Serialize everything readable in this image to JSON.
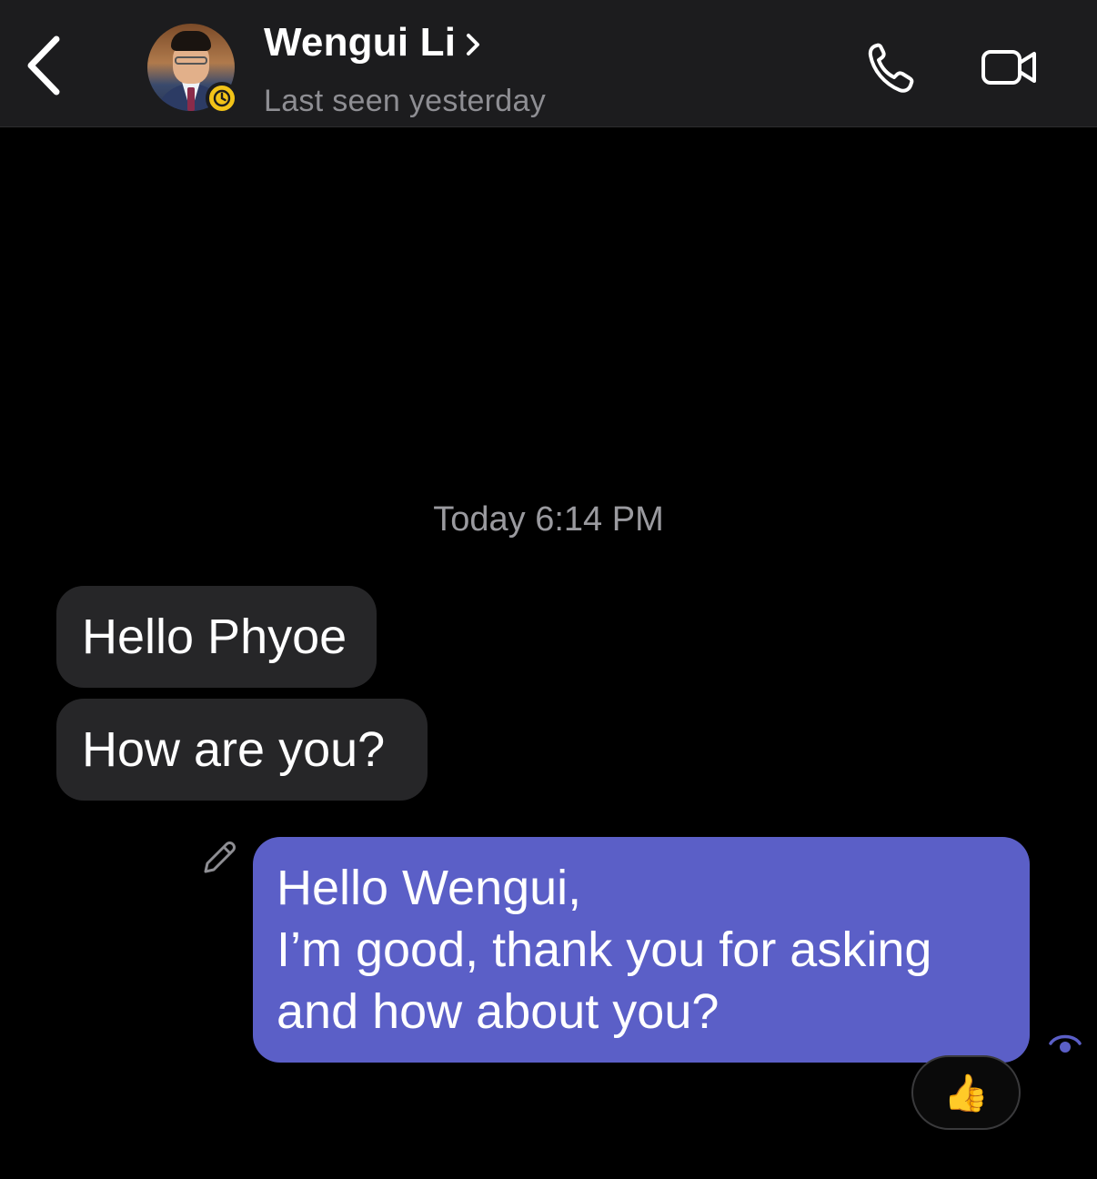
{
  "header": {
    "contact_name": "Wengui Li",
    "status": "Last seen yesterday",
    "back_icon": "chevron-left-icon",
    "call_icon": "phone-icon",
    "video_icon": "video-camera-icon"
  },
  "conversation": {
    "timestamp": "Today 6:14 PM",
    "incoming": [
      {
        "text": "Hello Phyoe"
      },
      {
        "text": "How are you?"
      }
    ],
    "outgoing": {
      "lines": [
        "Hello Wengui,",
        "I’m good, thank you for asking",
        "and how about you?"
      ],
      "edited_icon": "pencil-icon",
      "seen_icon": "eye-icon",
      "reaction": "👍"
    }
  },
  "colors": {
    "header_bg": "#1c1c1e",
    "incoming_bubble": "#262628",
    "outgoing_bubble": "#5b5fc7",
    "status_badge": "#f2c318"
  }
}
